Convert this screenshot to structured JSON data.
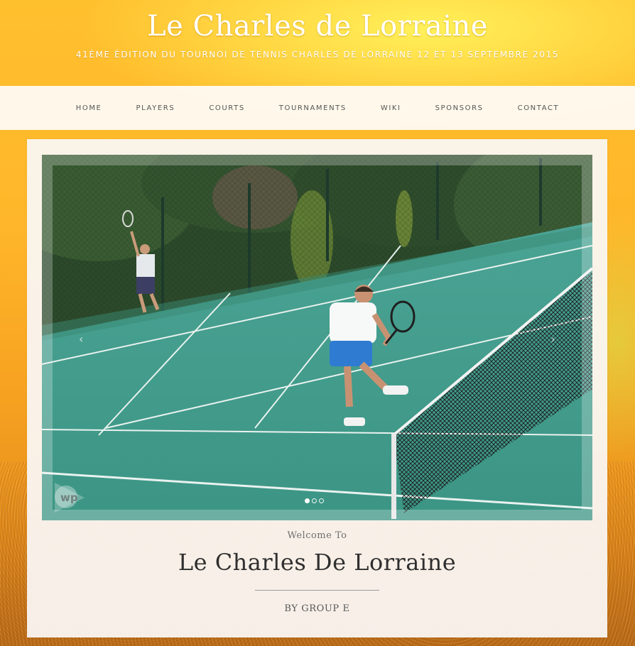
{
  "site": {
    "title": "Le Charles de Lorraine",
    "tagline": "41ème édition du tournoi de tennis Charles de Lorraine 12 et 13 septembre 2015"
  },
  "nav": {
    "items": [
      "HOME",
      "PLAYERS",
      "COURTS",
      "TOURNAMENTS",
      "WIKI",
      "SPONSORS",
      "CONTACT"
    ]
  },
  "slider": {
    "image": "tennis-doubles-photo",
    "prev_icon": "chevron-left-icon",
    "next_icon": "chevron-right-icon",
    "prev_glyph": "‹",
    "next_glyph": "›",
    "slide_count": 3,
    "active_slide": 1
  },
  "hero": {
    "welcome": "Welcome To",
    "heading": "Le Charles De Lorraine",
    "byline": "BY GROUP E"
  },
  "colors": {
    "background_top": "#ffc02e",
    "background_bottom": "#c9761a",
    "nav_bg": "#fffaf3",
    "court": "#3f9e8c",
    "heading": "#2f2f2f"
  }
}
